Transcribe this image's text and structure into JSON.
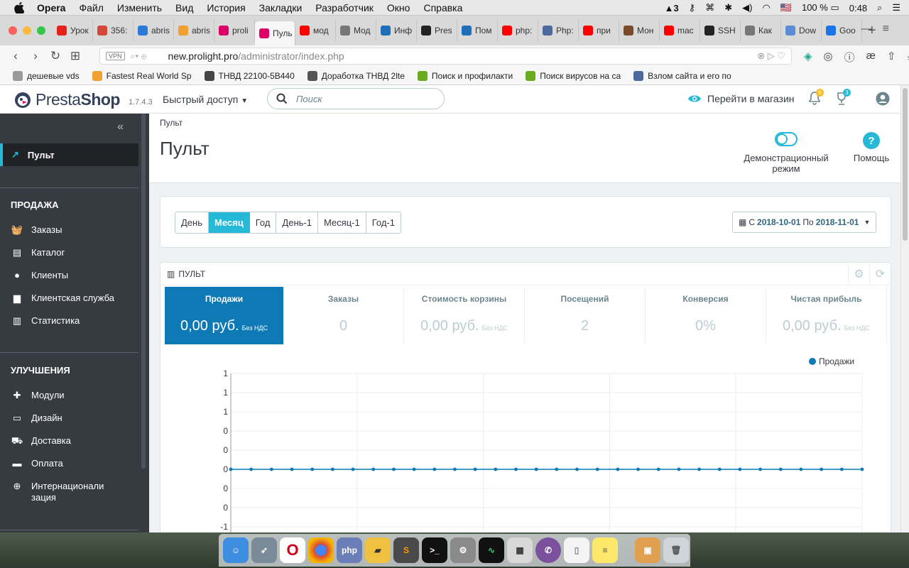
{
  "menubar": {
    "app": "Opera",
    "items": [
      "Файл",
      "Изменить",
      "Вид",
      "История",
      "Закладки",
      "Разработчик",
      "Окно",
      "Справка"
    ],
    "status": {
      "adobe_count": "3",
      "flag": "🇺🇸",
      "battery": "100 %",
      "time": "0:48"
    }
  },
  "tabs": [
    {
      "label": "Урок",
      "color": "#e62117",
      "icon": "youtube-icon"
    },
    {
      "label": "356:",
      "color": "#d44638",
      "icon": "gmail-icon"
    },
    {
      "label": "abris",
      "color": "#2b7bd6",
      "icon": "abris-icon"
    },
    {
      "label": "abris",
      "color": "#f0a030",
      "icon": "phpmyadmin-icon"
    },
    {
      "label": "proli",
      "color": "#df0067",
      "icon": "prestashop-icon"
    },
    {
      "label": "Пуль",
      "color": "#df0067",
      "icon": "prestashop-icon",
      "active": true
    },
    {
      "label": "мод",
      "color": "#f00",
      "icon": "yandex-icon"
    },
    {
      "label": "Мод",
      "color": "#777",
      "icon": "doc-icon"
    },
    {
      "label": "Инф",
      "color": "#1d6fb8",
      "icon": "site-icon"
    },
    {
      "label": "Pres",
      "color": "#222",
      "icon": "terminal-icon"
    },
    {
      "label": "Пом",
      "color": "#1d6fb8",
      "icon": "site-icon"
    },
    {
      "label": "php:",
      "color": "#f00",
      "icon": "yandex-icon"
    },
    {
      "label": "Php:",
      "color": "#4b6a9b",
      "icon": "habr-icon"
    },
    {
      "label": "при",
      "color": "#f00",
      "icon": "yandex-icon"
    },
    {
      "label": "Мон",
      "color": "#7a4b2a",
      "icon": "photo-icon"
    },
    {
      "label": "mac",
      "color": "#f00",
      "icon": "yandex-icon"
    },
    {
      "label": "SSH",
      "color": "#222",
      "icon": "github-icon"
    },
    {
      "label": "Как",
      "color": "#777",
      "icon": "doc-icon"
    },
    {
      "label": "Dow",
      "color": "#5b8dd6",
      "icon": "site-icon"
    },
    {
      "label": "Goo",
      "color": "#1a73e8",
      "icon": "site-icon"
    }
  ],
  "address": {
    "vpn": "VPN",
    "host": "new.prolight.pro",
    "path": "/administrator/index.php"
  },
  "bookmarks": [
    {
      "label": "дешевые vds",
      "icon": "folder-icon"
    },
    {
      "label": "Fastest Real World Sp",
      "icon": "clock-icon"
    },
    {
      "label": "ТНВД 22100-5В440",
      "icon": "photo-icon"
    },
    {
      "label": "Доработка ТНВД 2lte",
      "icon": "toyota-icon"
    },
    {
      "label": "Поиск и профилакти",
      "icon": "leaf-icon"
    },
    {
      "label": "Поиск вирусов на са",
      "icon": "leaf-icon"
    },
    {
      "label": "Взлом сайта и его по",
      "icon": "habr-icon"
    }
  ],
  "header": {
    "logo_a": "Presta",
    "logo_b": "Shop",
    "version": "1.7.4.3",
    "quick_access": "Быстрый доступ",
    "search_placeholder": "Поиск",
    "visit_store": "Перейти в магазин",
    "notifications": "6",
    "trophies": "3"
  },
  "sidebar": {
    "active": "Пульт",
    "sections": [
      {
        "title": "ПРОДАЖА",
        "items": [
          "Заказы",
          "Каталог",
          "Клиенты",
          "Клиентская служба",
          "Статистика"
        ]
      },
      {
        "title": "УЛУЧШЕНИЯ",
        "items": [
          "Модули",
          "Дизайн",
          "Доставка",
          "Оплата",
          "Интернационализация"
        ]
      }
    ]
  },
  "page": {
    "breadcrumb": "Пульт",
    "title": "Пульт",
    "demo_mode": "Демонстрационный режим",
    "help": "Помощь"
  },
  "periods": [
    "День",
    "Месяц",
    "Год",
    "День-1",
    "Месяц-1",
    "Год-1"
  ],
  "active_period": "Месяц",
  "date_range": {
    "from_label": "С",
    "from": "2018-10-01",
    "to_label": "По",
    "to": "2018-11-01"
  },
  "dashboard": {
    "title": "ПУЛЬТ",
    "kpis": [
      {
        "label": "Продажи",
        "value": "0,00 руб.",
        "suffix": "Без НДС",
        "active": true
      },
      {
        "label": "Заказы",
        "value": "0",
        "suffix": ""
      },
      {
        "label": "Стоимость корзины",
        "value": "0,00 руб.",
        "suffix": "Без НДС"
      },
      {
        "label": "Посещений",
        "value": "2",
        "suffix": ""
      },
      {
        "label": "Конверсия",
        "value": "0%",
        "suffix": ""
      },
      {
        "label": "Чистая прибыль",
        "value": "0,00 руб.",
        "suffix": "Без НДС"
      }
    ]
  },
  "colors": {
    "accent": "#25b9d7",
    "kpi_active": "#0d79b5",
    "sidebar": "#363a41"
  },
  "chart_data": {
    "type": "line",
    "series": [
      {
        "name": "Продажи",
        "values": [
          0,
          0,
          0,
          0,
          0,
          0,
          0,
          0,
          0,
          0,
          0,
          0,
          0,
          0,
          0,
          0,
          0,
          0,
          0,
          0,
          0,
          0,
          0,
          0,
          0,
          0,
          0,
          0,
          0,
          0,
          0,
          0
        ]
      }
    ],
    "y_tick_labels": [
      "1",
      "1",
      "1",
      "0",
      "0",
      "0",
      "0",
      "0",
      "-1"
    ],
    "legend": "top-right",
    "grid": true
  }
}
